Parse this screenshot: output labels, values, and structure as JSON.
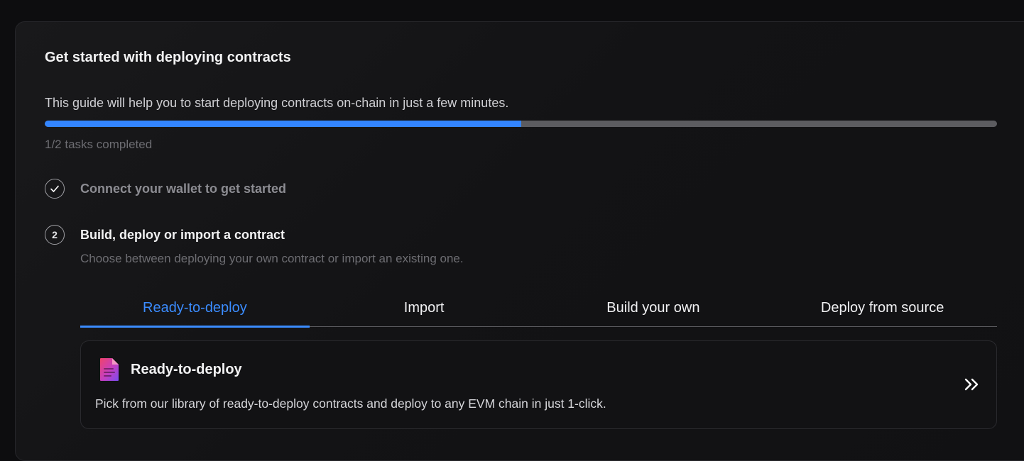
{
  "guide": {
    "title": "Get started with deploying contracts",
    "subtitle": "This guide will help you to start deploying contracts on-chain in just a few minutes.",
    "progress": {
      "completed": 1,
      "total": 2,
      "label": "1/2 tasks completed"
    },
    "colors": {
      "accent": "#3385ff",
      "track": "#5c5c60"
    }
  },
  "steps": [
    {
      "marker": "check-icon",
      "title": "Connect your wallet to get started",
      "status": "completed"
    },
    {
      "marker": "2",
      "title": "Build, deploy or import a contract",
      "description": "Choose between deploying your own contract or import an existing one.",
      "status": "current"
    }
  ],
  "tabs": [
    {
      "label": "Ready-to-deploy",
      "active": true
    },
    {
      "label": "Import",
      "active": false
    },
    {
      "label": "Build your own",
      "active": false
    },
    {
      "label": "Deploy from source",
      "active": false
    }
  ],
  "feature": {
    "icon": "document-icon",
    "title": "Ready-to-deploy",
    "description": "Pick from our library of ready-to-deploy contracts and deploy to any EVM chain in just 1-click.",
    "action_icon": "double-chevron-right-icon"
  }
}
